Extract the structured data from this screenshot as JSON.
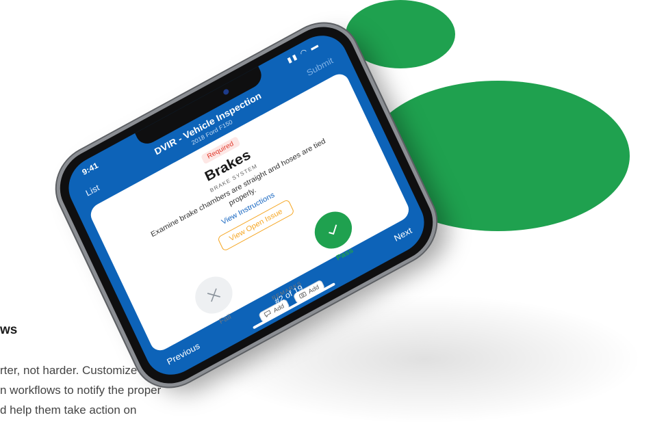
{
  "side_copy": {
    "heading": "ws",
    "lines": [
      "rter, not harder. Customize",
      "n workflows to notify the proper",
      "d help them take action on"
    ]
  },
  "colors": {
    "brand_green": "#1fa14f",
    "app_blue": "#0d63b8",
    "required_red": "#e1392c",
    "issue_orange": "#f5a623"
  },
  "status_bar": {
    "time": "9:41",
    "icons": "signal wifi battery"
  },
  "header": {
    "list_label": "List",
    "title": "DVIR - Vehicle Inspection",
    "subtitle": "2018 Ford F150",
    "submit_label": "Submit"
  },
  "inspection_item": {
    "required_label": "Required",
    "title": "Brakes",
    "category": "BRAKE SYSTEM",
    "description": "Examine brake chambers are straight and hoses are tied properly.",
    "instructions_link": "View Instructions",
    "open_issue_button": "View Open Issue"
  },
  "actions": {
    "fail_label": "Fail",
    "fail_icon": "x-icon",
    "pass_label": "Pass",
    "pass_icon": "check-icon"
  },
  "remarks": {
    "label": "REMARKS",
    "comment_add_label": "Add",
    "photo_add_label": "Add"
  },
  "footer": {
    "previous_label": "Previous",
    "position": "#2 of 19",
    "next_label": "Next"
  }
}
